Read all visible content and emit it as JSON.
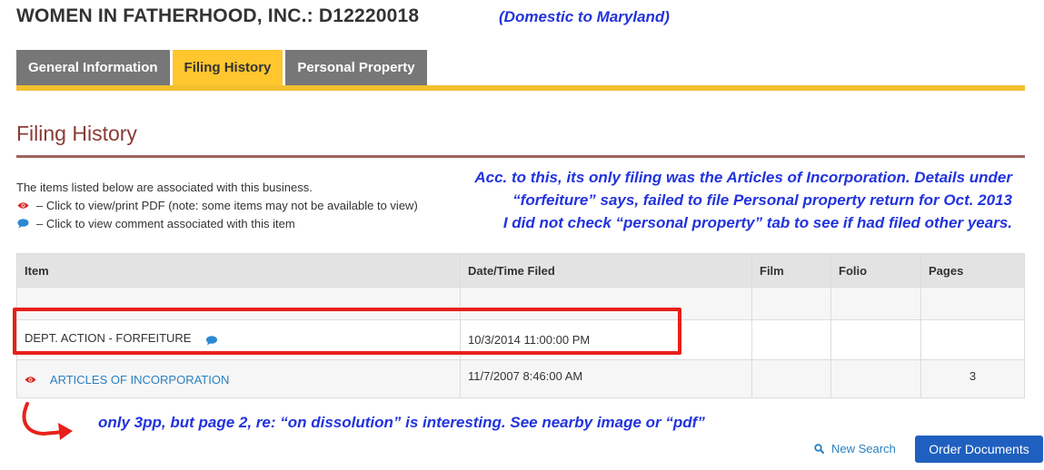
{
  "header": {
    "entity_title": "WOMEN IN FATHERHOOD, INC.: D12220018",
    "domestic_note": "(Domestic to Maryland)"
  },
  "tabs": [
    {
      "label": "General Information",
      "active": false
    },
    {
      "label": "Filing History",
      "active": true
    },
    {
      "label": "Personal Property",
      "active": false
    }
  ],
  "section": {
    "title": "Filing History",
    "intro": "The items listed below are associated with this business.",
    "legend_pdf": "– Click to view/print PDF (note: some items may not be available to view)",
    "legend_comment": "– Click to view comment associated with this item"
  },
  "annotation": {
    "line1": "Acc. to this, its only filing was the Articles of Incorporation.  Details under",
    "line2": "“forfeiture” says, failed to file Personal property return for Oct. 2013",
    "line3": "I did not check “personal property” tab to see if had filed other years."
  },
  "table": {
    "headers": {
      "item": "Item",
      "date": "Date/Time Filed",
      "film": "Film",
      "folio": "Folio",
      "pages": "Pages"
    },
    "rows": [
      {
        "item": "DEPT. ACTION - FORFEITURE",
        "date": "10/3/2014 11:00:00 PM",
        "film": "",
        "folio": "",
        "pages": ""
      },
      {
        "item": "ARTICLES OF INCORPORATION",
        "date": "11/7/2007 8:46:00 AM",
        "film": "",
        "folio": "",
        "pages": "3"
      }
    ]
  },
  "bottom_note": "only 3pp, but page 2, re: “on dissolution” is interesting. See nearby image or “pdf”",
  "actions": {
    "new_search": "New Search",
    "order_documents": "Order Documents"
  },
  "icons": {
    "pdf": "eye-icon",
    "comment": "comment-icon",
    "search": "search-icon"
  },
  "colors": {
    "active_tab": "#ffc62d",
    "inactive_tab": "#777777",
    "section_title": "#8a3a36",
    "annotation": "#2233dd",
    "highlight": "#e8201a",
    "link": "#2a7fbf",
    "button": "#1f5fbf"
  }
}
